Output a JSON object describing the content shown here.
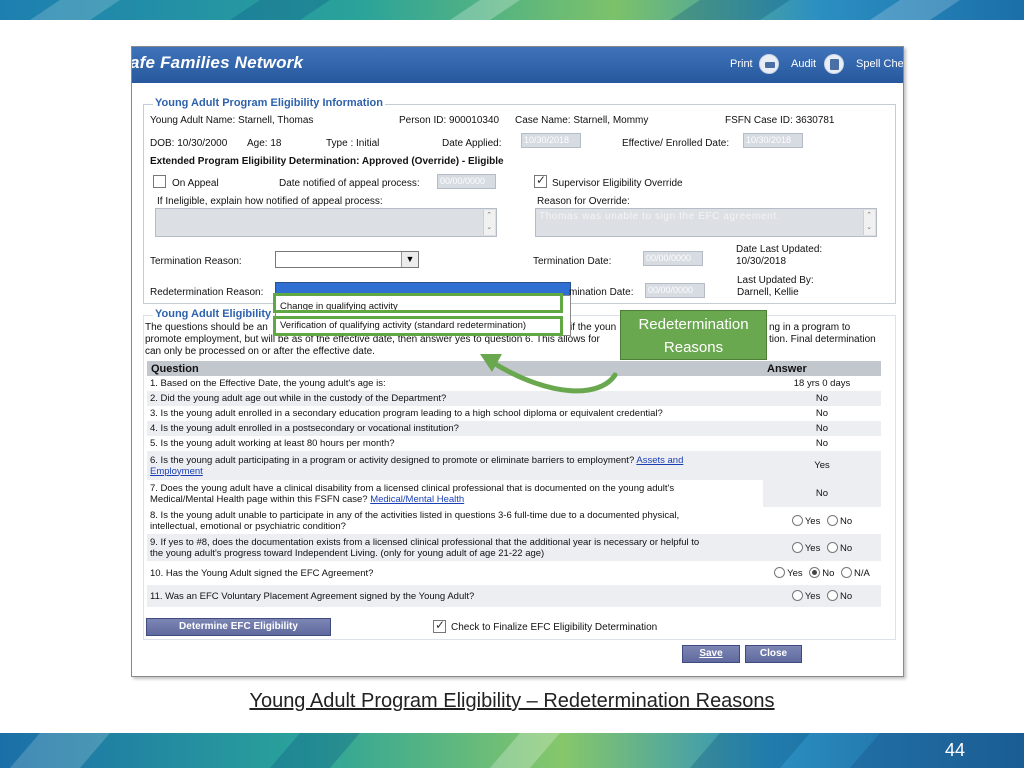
{
  "app": {
    "brand": "afe Families Network",
    "header_links": {
      "print": "Print",
      "audit": "Audit",
      "spell": "Spell Che"
    }
  },
  "eligibility_info": {
    "legend": "Young Adult Program Eligibility Information",
    "name": "Young Adult Name: Starnell, Thomas",
    "person_id": "Person ID: 900010340",
    "case_name": "Case Name: Starnell, Mommy",
    "fsfn_case_id": "FSFN Case ID: 3630781",
    "dob": "DOB: 10/30/2000",
    "age": "Age: 18",
    "type": "Type : Initial",
    "date_applied_label": "Date Applied:",
    "date_applied": "10/30/2018",
    "effective_label": "Effective/ Enrolled Date:",
    "effective_date": "10/30/2018",
    "determination": "Extended Program Eligibility Determination: Approved (Override) - Eligible",
    "on_appeal": "On Appeal",
    "date_notified_label": "Date notified of appeal process:",
    "date_notified_placeholder": "00/00/0000",
    "supervisor_override": "Supervisor Eligibility Override",
    "ineligible_label": "If Ineligible, explain how notified of appeal process:",
    "override_reason_label": "Reason for Override:",
    "override_reason": "Thomas was unable to sign the EFC agreement.",
    "termination_reason_label": "Termination Reason:",
    "termination_date_label": "Termination Date:",
    "termination_date_placeholder": "00/00/0000",
    "date_last_updated_label": "Date Last Updated:",
    "date_last_updated": "10/30/2018",
    "redetermination_label": "Redetermination Reason:",
    "redetermination_date_label": "mination Date:",
    "redetermination_date_placeholder": "00/00/0000",
    "last_updated_by_label": "Last Updated By:",
    "last_updated_by": "Darnell, Kellie"
  },
  "dropdown_options": [
    "Change in qualifying activity",
    "Verification of qualifying activity (standard redetermination)"
  ],
  "eligibility_section": {
    "legend": "Young Adult Eligibility",
    "intro_1": "The questions should be an",
    "intro_1b": "if the youn",
    "intro_1c": "ng in a program to",
    "intro_2": "promote employment, but will be as of the effective date, then answer yes to question 6. This allows for",
    "intro_2b": "tion. Final determination",
    "intro_3": "can only be processed on or after the effective date."
  },
  "table": {
    "headers": {
      "question": "Question",
      "answer": "Answer"
    },
    "rows": [
      {
        "q": "1. Based on the Effective Date, the young adult's age is:",
        "a": "18 yrs 0 days"
      },
      {
        "q": "2. Did the young adult age out while in the custody of the Department?",
        "a": "No"
      },
      {
        "q": "3. Is the young adult enrolled in a secondary education program leading to a high school diploma or equivalent credential?",
        "a": "No"
      },
      {
        "q": "4. Is the young adult enrolled in a postsecondary or vocational institution?",
        "a": "No"
      },
      {
        "q": "5. Is the young adult working at least 80 hours per month?",
        "a": "No"
      },
      {
        "q": "6. Is the young adult participating in a program or activity designed to promote or eliminate barriers to employment?",
        "link": "Assets and",
        "link2": "Employment",
        "a": "Yes"
      },
      {
        "q": "7. Does the young adult have a clinical disability from a licensed clinical professional that is documented on the young adult's",
        "q2": "Medical/Mental Health page within this FSFN case?",
        "link": "Medical/Mental Health",
        "a": "No"
      },
      {
        "q": "8. Is the young adult unable to participate in any of the activities listed in questions 3-6 full-time due to a documented physical,",
        "q2": "intellectual, emotional or psychiatric condition?"
      },
      {
        "q": "9. If yes to #8, does the documentation exists from a licensed clinical professional that the additional year is necessary or helpful to",
        "q2": "the young adult's progress toward Independent Living. (only for young adult of age 21-22 age)"
      },
      {
        "q": "10. Has the Young Adult signed the EFC Agreement?"
      },
      {
        "q": "11. Was an EFC Voluntary Placement Agreement signed by the Young Adult?"
      }
    ],
    "radio_labels": {
      "yes": "Yes",
      "no": "No",
      "na": "N/A"
    }
  },
  "actions": {
    "determine": "Determine EFC Eligibility",
    "finalize": "Check to Finalize EFC Eligibility Determination",
    "save": "Save",
    "close": "Close"
  },
  "callout": {
    "line1": "Redetermination",
    "line2": "Reasons"
  },
  "slide": {
    "caption": "Young Adult Program Eligibility – Redetermination Reasons",
    "page_number": "44"
  },
  "colors": {
    "header_blue": "#2e62ad",
    "callout_green": "#6aa84f",
    "button_blue": "#5f6a9e"
  }
}
